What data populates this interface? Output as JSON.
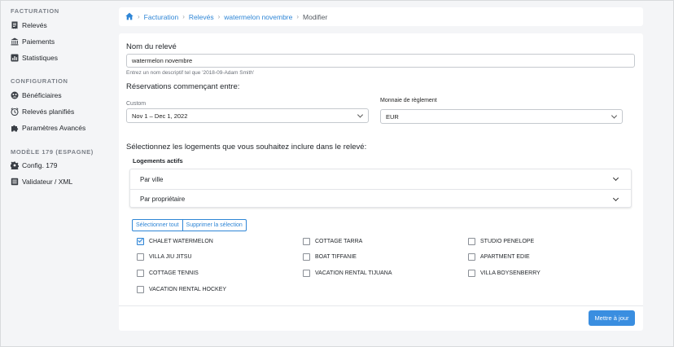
{
  "sidebar": {
    "sections": [
      {
        "title": "FACTURATION",
        "items": [
          {
            "label": "Relevés",
            "icon": "receipt-icon"
          },
          {
            "label": "Paiements",
            "icon": "bank-icon"
          },
          {
            "label": "Statistiques",
            "icon": "chart-icon"
          }
        ]
      },
      {
        "title": "CONFIGURATION",
        "items": [
          {
            "label": "Bénéficiaires",
            "icon": "users-icon"
          },
          {
            "label": "Relevés planifiés",
            "icon": "clock-icon"
          },
          {
            "label": "Paramètres Avancés",
            "icon": "puzzle-icon"
          }
        ]
      },
      {
        "title": "MODÈLE 179 (ESPAGNE)",
        "items": [
          {
            "label": "Config. 179",
            "icon": "gear-icon"
          },
          {
            "label": "Validateur / XML",
            "icon": "document-icon"
          }
        ]
      }
    ]
  },
  "breadcrumb": {
    "items": [
      "Facturation",
      "Relevés",
      "watermelon novembre"
    ],
    "current": "Modifier"
  },
  "form": {
    "name_label": "Nom du relevé",
    "name_value": "watermelon novembre",
    "name_help": "Entrez un nom descriptif tel que '2018-09-Adam Smith'",
    "reservations_label": "Réservations commençant entre:",
    "range_label": "Custom",
    "range_value": "Nov 1 – Dec 1, 2022",
    "currency_label": "Monnaie de règlement",
    "currency_value": "EUR",
    "properties_label": "Sélectionnez les logements que vous souhaitez inclure dans le relevé:",
    "active_label": "Logements actifs",
    "accordion": [
      "Par ville",
      "Par propriétaire"
    ],
    "select_all": "Sélectionner tout",
    "clear_selection": "Supprimer la sélection",
    "properties": [
      {
        "name": "CHALET WATERMELON",
        "checked": true
      },
      {
        "name": "COTTAGE TARRA",
        "checked": false
      },
      {
        "name": "STUDIO PENELOPE",
        "checked": false
      },
      {
        "name": "VILLA JIU JITSU",
        "checked": false
      },
      {
        "name": "BOAT TIFFANIE",
        "checked": false
      },
      {
        "name": "APARTMENT EDIE",
        "checked": false
      },
      {
        "name": "COTTAGE TENNIS",
        "checked": false
      },
      {
        "name": "VACATION RENTAL TIJUANA",
        "checked": false
      },
      {
        "name": "VILLA BOYSENBERRY",
        "checked": false
      },
      {
        "name": "VACATION RENTAL HOCKEY",
        "checked": false
      }
    ],
    "submit": "Mettre à jour"
  },
  "colors": {
    "accent": "#2f86d6",
    "primary_button": "#3a8ee0",
    "background": "#f4f5f7"
  }
}
